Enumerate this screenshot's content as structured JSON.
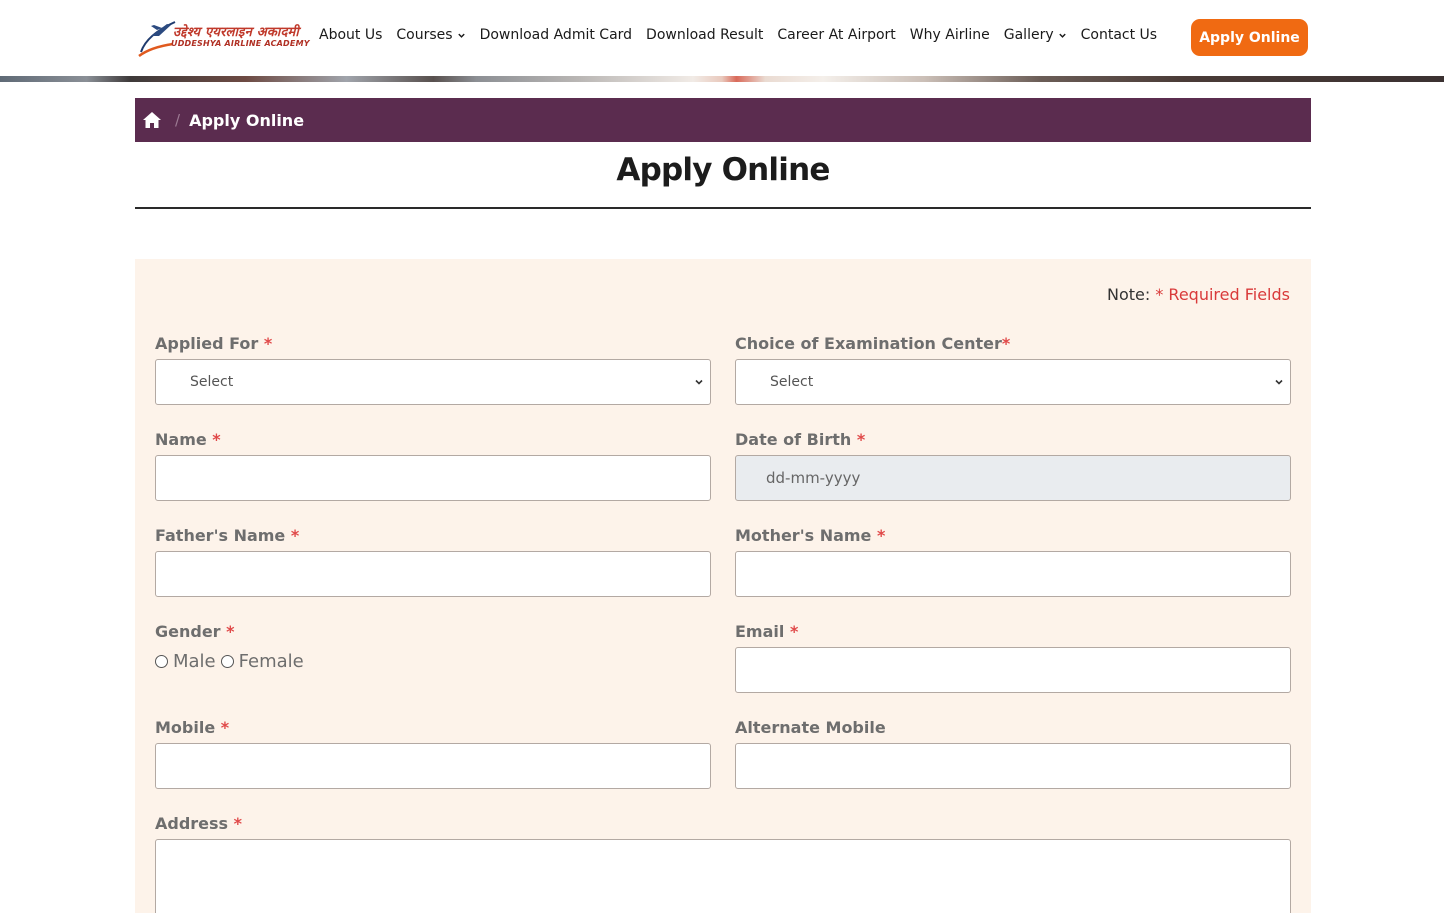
{
  "header": {
    "logo": {
      "hindi_text": "उद्देश्य एयरलाइन अकादमी",
      "english_text": "UDDESHYA AIRLINE ACADEMY",
      "colors": {
        "primary": "#c0392b",
        "accent": "#f06a12"
      }
    },
    "nav": [
      {
        "label": "About Us",
        "has_dropdown": false
      },
      {
        "label": "Courses",
        "has_dropdown": true
      },
      {
        "label": "Download Admit Card",
        "has_dropdown": false
      },
      {
        "label": "Download Result",
        "has_dropdown": false
      },
      {
        "label": "Career At Airport",
        "has_dropdown": false
      },
      {
        "label": "Why Airline",
        "has_dropdown": false
      },
      {
        "label": "Gallery",
        "has_dropdown": true
      },
      {
        "label": "Contact Us",
        "has_dropdown": false
      }
    ],
    "apply_button": {
      "label": "Apply Online",
      "color": "#f06a12"
    }
  },
  "breadcrumb": {
    "home_icon": "home-icon",
    "separator": "/",
    "current": "Apply Online",
    "background": "#5b2c4f"
  },
  "page": {
    "title": "Apply Online"
  },
  "form": {
    "note": {
      "prefix": "Note:",
      "required_text": "* Required Fields"
    },
    "required_marker": "*",
    "fields": {
      "applied_for": {
        "label": "Applied For",
        "value": "Select"
      },
      "exam_center": {
        "label": "Choice of Examination Center",
        "value": "Select"
      },
      "name": {
        "label": "Name",
        "value": ""
      },
      "dob": {
        "label": "Date of Birth",
        "placeholder": "dd-mm-yyyy"
      },
      "father_name": {
        "label": "Father's Name",
        "value": ""
      },
      "mother_name": {
        "label": "Mother's Name",
        "value": ""
      },
      "gender": {
        "label": "Gender",
        "options": [
          "Male",
          "Female"
        ]
      },
      "email": {
        "label": "Email",
        "value": ""
      },
      "mobile": {
        "label": "Mobile",
        "value": ""
      },
      "alternate_mobile": {
        "label": "Alternate Mobile",
        "value": ""
      },
      "address": {
        "label": "Address",
        "value": ""
      }
    },
    "panel_background": "#fdf3ea"
  }
}
